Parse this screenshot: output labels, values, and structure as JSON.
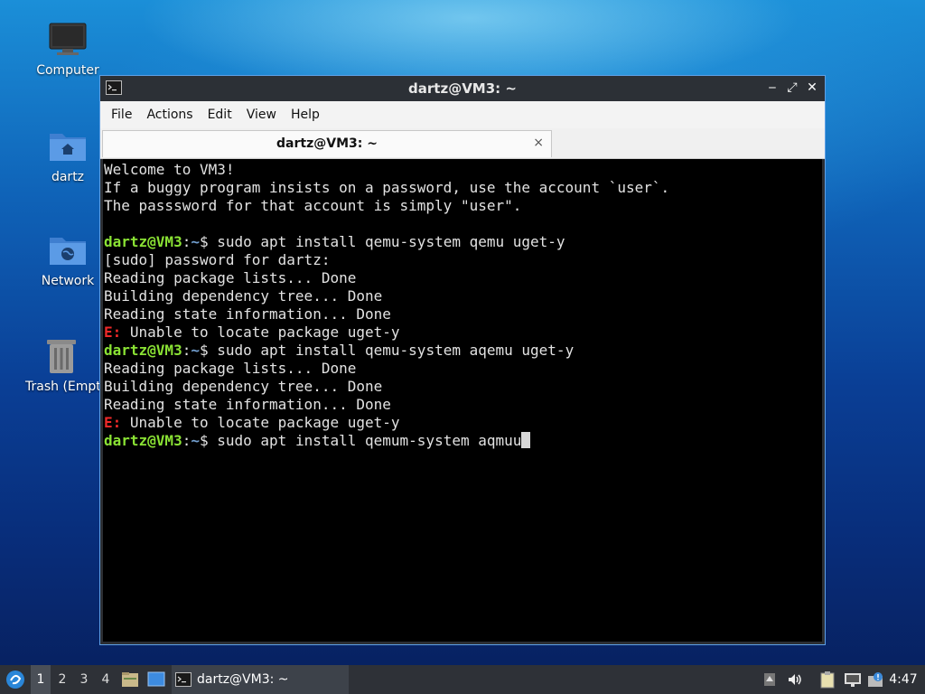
{
  "desktop": {
    "icons": [
      {
        "label": "Computer",
        "icon": "monitor-icon"
      },
      {
        "label": "dartz",
        "icon": "home-folder-icon"
      },
      {
        "label": "Network",
        "icon": "network-folder-icon"
      },
      {
        "label": "Trash (Empty)",
        "icon": "trash-icon"
      }
    ]
  },
  "window": {
    "title": "dartz@VM3: ~",
    "menu": [
      "File",
      "Actions",
      "Edit",
      "View",
      "Help"
    ],
    "tab_label": "dartz@VM3: ~",
    "tab_close": "×",
    "controls": {
      "minimize": "‒",
      "maximize": "⤢",
      "close": "✕"
    }
  },
  "terminal": {
    "prompt_user": "dartz@VM3",
    "prompt_colon": ":",
    "prompt_path": "~",
    "prompt_dollar": "$ ",
    "error_tag": "E:",
    "lines": {
      "l1": "Welcome to VM3!",
      "l2": "If a buggy program insists on a password, use the account `user`.",
      "l3": "The passsword for that account is simply \"user\".",
      "cmd1": "sudo apt install qemu-system qemu uget-y",
      "l5": "[sudo] password for dartz:",
      "l6": "Reading package lists... Done",
      "l7": "Building dependency tree... Done",
      "l8": "Reading state information... Done",
      "err1": " Unable to locate package uget-y",
      "cmd2": "sudo apt install qemu-system aqemu uget-y",
      "l11": "Reading package lists... Done",
      "l12": "Building dependency tree... Done",
      "l13": "Reading state information... Done",
      "err2": " Unable to locate package uget-y",
      "cmd3": "sudo apt install qemum-system aqmuu"
    }
  },
  "taskbar": {
    "workspaces": [
      "1",
      "2",
      "3",
      "4"
    ],
    "active_workspace": "1",
    "task_label": "dartz@VM3: ~",
    "clock": "4:47"
  },
  "colors": {
    "prompt_user": "#8ae234",
    "prompt_path": "#729fcf",
    "error": "#ef2929",
    "window_border": "#5ea0e6"
  }
}
